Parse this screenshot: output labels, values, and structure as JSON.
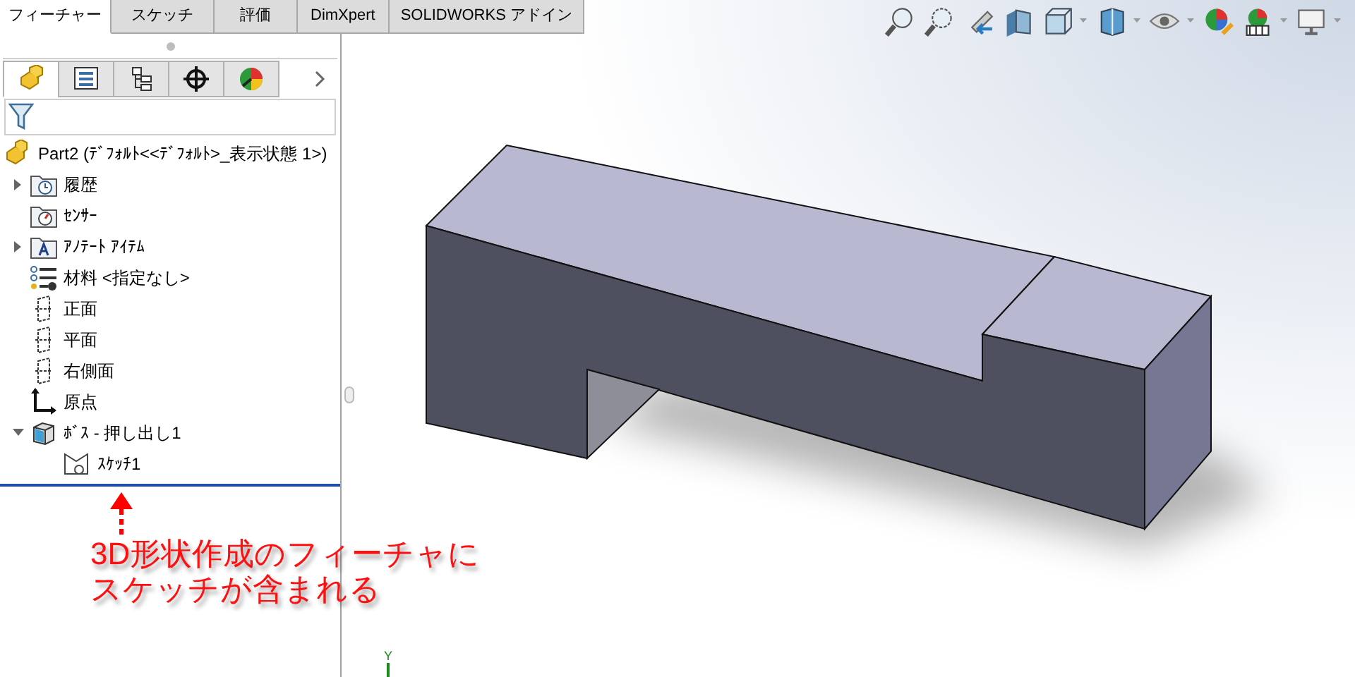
{
  "command_tabs": [
    {
      "label": "フィーチャー",
      "selected": true
    },
    {
      "label": "スケッチ",
      "selected": false
    },
    {
      "label": "評価",
      "selected": false
    },
    {
      "label": "DimXpert",
      "selected": false
    },
    {
      "label": "SOLIDWORKS アドイン",
      "selected": false
    }
  ],
  "panel_tabs": [
    {
      "kind": "feature",
      "selected": true
    },
    {
      "kind": "property",
      "selected": false
    },
    {
      "kind": "config",
      "selected": false
    },
    {
      "kind": "dimxpert",
      "selected": false
    },
    {
      "kind": "display",
      "selected": false
    }
  ],
  "tree": {
    "label": "Part2 (ﾃﾞﾌｫﾙﾄ<<ﾃﾞﾌｫﾙﾄ>_表示状態 1>)",
    "kind": "part",
    "children": [
      {
        "label": "履歴",
        "kind": "history",
        "expanded": false
      },
      {
        "label": "ｾﾝｻｰ",
        "kind": "sensor"
      },
      {
        "label": "ｱﾉﾃｰﾄ ｱｲﾃﾑ",
        "kind": "annotation",
        "expanded": false
      },
      {
        "label": "材料 <指定なし>",
        "kind": "material"
      },
      {
        "label": "正面",
        "kind": "plane"
      },
      {
        "label": "平面",
        "kind": "plane"
      },
      {
        "label": "右側面",
        "kind": "plane"
      },
      {
        "label": "原点",
        "kind": "origin"
      },
      {
        "label": "ﾎﾞｽ - 押し出し1",
        "kind": "extrude",
        "expanded": true,
        "children": [
          {
            "label": "ｽｹｯﾁ1",
            "kind": "sketch"
          }
        ]
      }
    ]
  },
  "annotation": {
    "lines": [
      "3D形状作成のフィーチャに",
      "スケッチが含まれる"
    ]
  },
  "triad": {
    "label": "Y"
  }
}
